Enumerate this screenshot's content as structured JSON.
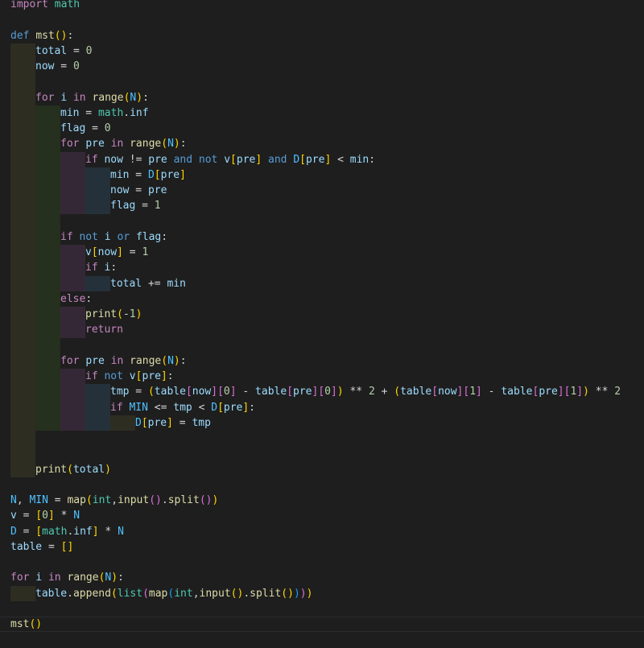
{
  "editor": {
    "language": "python",
    "theme": {
      "background": "#1e1e1e",
      "keyword": "#569cd6",
      "control": "#c586c0",
      "function": "#dcdcaa",
      "variable": "#9cdcfe",
      "constant": "#4fc1ff",
      "number": "#b5cea8",
      "class": "#4ec9b0",
      "bracket1": "#ffd700",
      "bracket2": "#da70d6",
      "bracket3": "#179fff"
    },
    "lines": [
      {
        "indent": 0,
        "tokens": [
          [
            "ctl",
            "import"
          ],
          [
            "op",
            " "
          ],
          [
            "cls",
            "math"
          ]
        ]
      },
      {
        "indent": 0,
        "tokens": []
      },
      {
        "indent": 0,
        "tokens": [
          [
            "kw",
            "def"
          ],
          [
            "op",
            " "
          ],
          [
            "fn",
            "mst"
          ],
          [
            "b1",
            "()"
          ],
          [
            "op",
            ":"
          ]
        ]
      },
      {
        "indent": 1,
        "tokens": [
          [
            "var",
            "total"
          ],
          [
            "op",
            " = "
          ],
          [
            "num",
            "0"
          ]
        ]
      },
      {
        "indent": 1,
        "tokens": [
          [
            "var",
            "now"
          ],
          [
            "op",
            " = "
          ],
          [
            "num",
            "0"
          ]
        ]
      },
      {
        "indent": 1,
        "tokens": []
      },
      {
        "indent": 1,
        "tokens": [
          [
            "ctl",
            "for"
          ],
          [
            "op",
            " "
          ],
          [
            "var",
            "i"
          ],
          [
            "op",
            " "
          ],
          [
            "ctl",
            "in"
          ],
          [
            "op",
            " "
          ],
          [
            "fn",
            "range"
          ],
          [
            "b1",
            "("
          ],
          [
            "cst",
            "N"
          ],
          [
            "b1",
            ")"
          ],
          [
            "op",
            ":"
          ]
        ]
      },
      {
        "indent": 2,
        "tokens": [
          [
            "var",
            "min"
          ],
          [
            "op",
            " = "
          ],
          [
            "cls",
            "math"
          ],
          [
            "op",
            "."
          ],
          [
            "var",
            "inf"
          ]
        ]
      },
      {
        "indent": 2,
        "tokens": [
          [
            "var",
            "flag"
          ],
          [
            "op",
            " = "
          ],
          [
            "num",
            "0"
          ]
        ]
      },
      {
        "indent": 2,
        "tokens": [
          [
            "ctl",
            "for"
          ],
          [
            "op",
            " "
          ],
          [
            "var",
            "pre"
          ],
          [
            "op",
            " "
          ],
          [
            "ctl",
            "in"
          ],
          [
            "op",
            " "
          ],
          [
            "fn",
            "range"
          ],
          [
            "b1",
            "("
          ],
          [
            "cst",
            "N"
          ],
          [
            "b1",
            ")"
          ],
          [
            "op",
            ":"
          ]
        ]
      },
      {
        "indent": 3,
        "tokens": [
          [
            "ctl",
            "if"
          ],
          [
            "op",
            " "
          ],
          [
            "var",
            "now"
          ],
          [
            "op",
            " != "
          ],
          [
            "var",
            "pre"
          ],
          [
            "op",
            " "
          ],
          [
            "kw",
            "and"
          ],
          [
            "op",
            " "
          ],
          [
            "kw",
            "not"
          ],
          [
            "op",
            " "
          ],
          [
            "var",
            "v"
          ],
          [
            "b1",
            "["
          ],
          [
            "var",
            "pre"
          ],
          [
            "b1",
            "]"
          ],
          [
            "op",
            " "
          ],
          [
            "kw",
            "and"
          ],
          [
            "op",
            " "
          ],
          [
            "cst",
            "D"
          ],
          [
            "b1",
            "["
          ],
          [
            "var",
            "pre"
          ],
          [
            "b1",
            "]"
          ],
          [
            "op",
            " < "
          ],
          [
            "var",
            "min"
          ],
          [
            "op",
            ":"
          ]
        ]
      },
      {
        "indent": 4,
        "tokens": [
          [
            "var",
            "min"
          ],
          [
            "op",
            " = "
          ],
          [
            "cst",
            "D"
          ],
          [
            "b1",
            "["
          ],
          [
            "var",
            "pre"
          ],
          [
            "b1",
            "]"
          ]
        ]
      },
      {
        "indent": 4,
        "tokens": [
          [
            "var",
            "now"
          ],
          [
            "op",
            " = "
          ],
          [
            "var",
            "pre"
          ]
        ]
      },
      {
        "indent": 4,
        "tokens": [
          [
            "var",
            "flag"
          ],
          [
            "op",
            " = "
          ],
          [
            "num",
            "1"
          ]
        ]
      },
      {
        "indent": 2,
        "tokens": []
      },
      {
        "indent": 2,
        "tokens": [
          [
            "ctl",
            "if"
          ],
          [
            "op",
            " "
          ],
          [
            "kw",
            "not"
          ],
          [
            "op",
            " "
          ],
          [
            "var",
            "i"
          ],
          [
            "op",
            " "
          ],
          [
            "kw",
            "or"
          ],
          [
            "op",
            " "
          ],
          [
            "var",
            "flag"
          ],
          [
            "op",
            ":"
          ]
        ]
      },
      {
        "indent": 3,
        "tokens": [
          [
            "var",
            "v"
          ],
          [
            "b1",
            "["
          ],
          [
            "var",
            "now"
          ],
          [
            "b1",
            "]"
          ],
          [
            "op",
            " = "
          ],
          [
            "num",
            "1"
          ]
        ]
      },
      {
        "indent": 3,
        "tokens": [
          [
            "ctl",
            "if"
          ],
          [
            "op",
            " "
          ],
          [
            "var",
            "i"
          ],
          [
            "op",
            ":"
          ]
        ]
      },
      {
        "indent": 4,
        "tokens": [
          [
            "var",
            "total"
          ],
          [
            "op",
            " += "
          ],
          [
            "var",
            "min"
          ]
        ]
      },
      {
        "indent": 2,
        "tokens": [
          [
            "ctl",
            "else"
          ],
          [
            "op",
            ":"
          ]
        ]
      },
      {
        "indent": 3,
        "tokens": [
          [
            "fn",
            "print"
          ],
          [
            "b1",
            "("
          ],
          [
            "op",
            "-"
          ],
          [
            "num",
            "1"
          ],
          [
            "b1",
            ")"
          ]
        ]
      },
      {
        "indent": 3,
        "tokens": [
          [
            "ctl",
            "return"
          ]
        ]
      },
      {
        "indent": 2,
        "tokens": []
      },
      {
        "indent": 2,
        "tokens": [
          [
            "ctl",
            "for"
          ],
          [
            "op",
            " "
          ],
          [
            "var",
            "pre"
          ],
          [
            "op",
            " "
          ],
          [
            "ctl",
            "in"
          ],
          [
            "op",
            " "
          ],
          [
            "fn",
            "range"
          ],
          [
            "b1",
            "("
          ],
          [
            "cst",
            "N"
          ],
          [
            "b1",
            ")"
          ],
          [
            "op",
            ":"
          ]
        ]
      },
      {
        "indent": 3,
        "tokens": [
          [
            "ctl",
            "if"
          ],
          [
            "op",
            " "
          ],
          [
            "kw",
            "not"
          ],
          [
            "op",
            " "
          ],
          [
            "var",
            "v"
          ],
          [
            "b1",
            "["
          ],
          [
            "var",
            "pre"
          ],
          [
            "b1",
            "]"
          ],
          [
            "op",
            ":"
          ]
        ]
      },
      {
        "indent": 4,
        "tokens": [
          [
            "var",
            "tmp"
          ],
          [
            "op",
            " = "
          ],
          [
            "b1",
            "("
          ],
          [
            "var",
            "table"
          ],
          [
            "b2",
            "["
          ],
          [
            "var",
            "now"
          ],
          [
            "b2",
            "]"
          ],
          [
            "b2",
            "["
          ],
          [
            "num",
            "0"
          ],
          [
            "b2",
            "]"
          ],
          [
            "op",
            " - "
          ],
          [
            "var",
            "table"
          ],
          [
            "b2",
            "["
          ],
          [
            "var",
            "pre"
          ],
          [
            "b2",
            "]"
          ],
          [
            "b2",
            "["
          ],
          [
            "num",
            "0"
          ],
          [
            "b2",
            "]"
          ],
          [
            "b1",
            ")"
          ],
          [
            "op",
            " ** "
          ],
          [
            "num",
            "2"
          ],
          [
            "op",
            " + "
          ],
          [
            "b1",
            "("
          ],
          [
            "var",
            "table"
          ],
          [
            "b2",
            "["
          ],
          [
            "var",
            "now"
          ],
          [
            "b2",
            "]"
          ],
          [
            "b2",
            "["
          ],
          [
            "num",
            "1"
          ],
          [
            "b2",
            "]"
          ],
          [
            "op",
            " - "
          ],
          [
            "var",
            "table"
          ],
          [
            "b2",
            "["
          ],
          [
            "var",
            "pre"
          ],
          [
            "b2",
            "]"
          ],
          [
            "b2",
            "["
          ],
          [
            "num",
            "1"
          ],
          [
            "b2",
            "]"
          ],
          [
            "b1",
            ")"
          ],
          [
            "op",
            " ** "
          ],
          [
            "num",
            "2"
          ]
        ]
      },
      {
        "indent": 4,
        "tokens": [
          [
            "ctl",
            "if"
          ],
          [
            "op",
            " "
          ],
          [
            "cst",
            "MIN"
          ],
          [
            "op",
            " <= "
          ],
          [
            "var",
            "tmp"
          ],
          [
            "op",
            " < "
          ],
          [
            "cst",
            "D"
          ],
          [
            "b1",
            "["
          ],
          [
            "var",
            "pre"
          ],
          [
            "b1",
            "]"
          ],
          [
            "op",
            ":"
          ]
        ]
      },
      {
        "indent": 5,
        "tokens": [
          [
            "cst",
            "D"
          ],
          [
            "b1",
            "["
          ],
          [
            "var",
            "pre"
          ],
          [
            "b1",
            "]"
          ],
          [
            "op",
            " = "
          ],
          [
            "var",
            "tmp"
          ]
        ]
      },
      {
        "indent": 1,
        "tokens": []
      },
      {
        "indent": 1,
        "tokens": []
      },
      {
        "indent": 1,
        "tokens": [
          [
            "fn",
            "print"
          ],
          [
            "b1",
            "("
          ],
          [
            "var",
            "total"
          ],
          [
            "b1",
            ")"
          ]
        ]
      },
      {
        "indent": 0,
        "tokens": []
      },
      {
        "indent": 0,
        "tokens": [
          [
            "cst",
            "N"
          ],
          [
            "op",
            ", "
          ],
          [
            "cst",
            "MIN"
          ],
          [
            "op",
            " = "
          ],
          [
            "fn",
            "map"
          ],
          [
            "b1",
            "("
          ],
          [
            "cls",
            "int"
          ],
          [
            "op",
            ","
          ],
          [
            "fn",
            "input"
          ],
          [
            "b2",
            "()"
          ],
          [
            "op",
            "."
          ],
          [
            "fn",
            "split"
          ],
          [
            "b2",
            "()"
          ],
          [
            "b1",
            ")"
          ]
        ]
      },
      {
        "indent": 0,
        "tokens": [
          [
            "var",
            "v"
          ],
          [
            "op",
            " = "
          ],
          [
            "b1",
            "["
          ],
          [
            "num",
            "0"
          ],
          [
            "b1",
            "]"
          ],
          [
            "op",
            " * "
          ],
          [
            "cst",
            "N"
          ]
        ]
      },
      {
        "indent": 0,
        "tokens": [
          [
            "cst",
            "D"
          ],
          [
            "op",
            " = "
          ],
          [
            "b1",
            "["
          ],
          [
            "cls",
            "math"
          ],
          [
            "op",
            "."
          ],
          [
            "var",
            "inf"
          ],
          [
            "b1",
            "]"
          ],
          [
            "op",
            " * "
          ],
          [
            "cst",
            "N"
          ]
        ]
      },
      {
        "indent": 0,
        "tokens": [
          [
            "var",
            "table"
          ],
          [
            "op",
            " = "
          ],
          [
            "b1",
            "[]"
          ]
        ]
      },
      {
        "indent": 0,
        "tokens": []
      },
      {
        "indent": 0,
        "tokens": [
          [
            "ctl",
            "for"
          ],
          [
            "op",
            " "
          ],
          [
            "var",
            "i"
          ],
          [
            "op",
            " "
          ],
          [
            "ctl",
            "in"
          ],
          [
            "op",
            " "
          ],
          [
            "fn",
            "range"
          ],
          [
            "b1",
            "("
          ],
          [
            "cst",
            "N"
          ],
          [
            "b1",
            ")"
          ],
          [
            "op",
            ":"
          ]
        ]
      },
      {
        "indent": 1,
        "tokens": [
          [
            "var",
            "table"
          ],
          [
            "op",
            "."
          ],
          [
            "fn",
            "append"
          ],
          [
            "b1",
            "("
          ],
          [
            "cls",
            "list"
          ],
          [
            "b2",
            "("
          ],
          [
            "fn",
            "map"
          ],
          [
            "b3",
            "("
          ],
          [
            "cls",
            "int"
          ],
          [
            "op",
            ","
          ],
          [
            "fn",
            "input"
          ],
          [
            "b1",
            "()"
          ],
          [
            "op",
            "."
          ],
          [
            "fn",
            "split"
          ],
          [
            "b1",
            "()"
          ],
          [
            "b3",
            ")"
          ],
          [
            "b2",
            ")"
          ],
          [
            "b1",
            ")"
          ]
        ]
      },
      {
        "indent": 0,
        "tokens": []
      },
      {
        "indent": 0,
        "tokens": [
          [
            "fn",
            "mst"
          ],
          [
            "b1",
            "()"
          ]
        ]
      },
      {
        "indent": 0,
        "tokens": []
      }
    ]
  }
}
